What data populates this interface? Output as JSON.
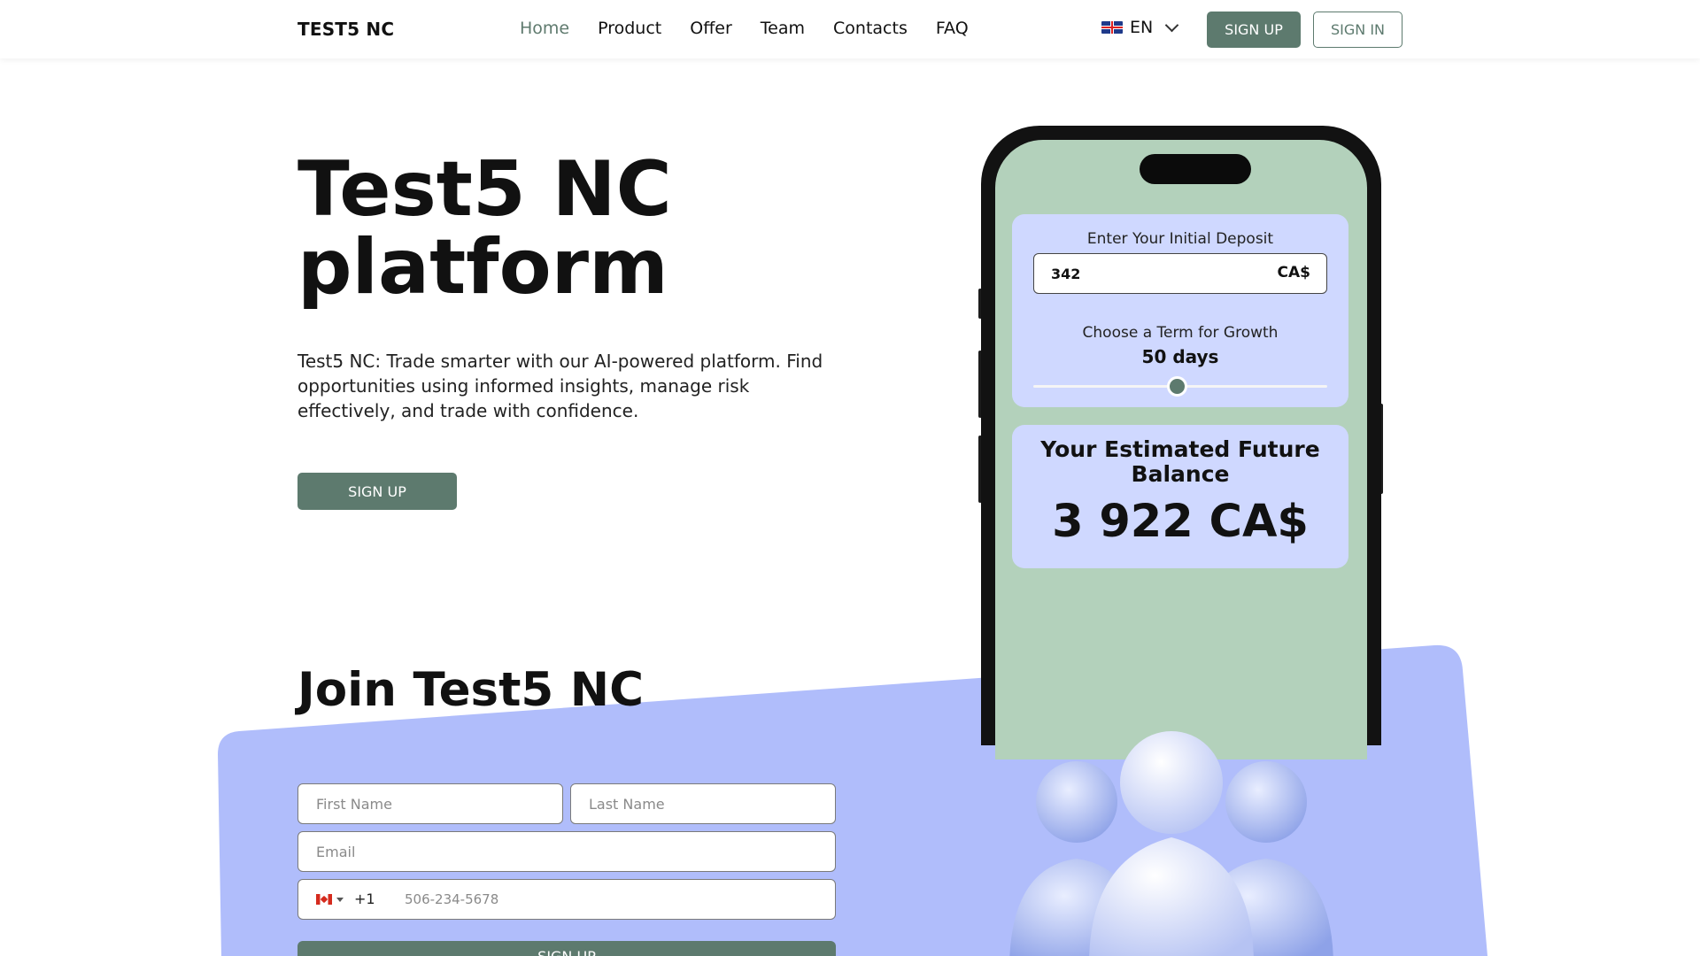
{
  "header": {
    "logo": "TEST5 NC",
    "nav": [
      {
        "label": "Home",
        "active": true
      },
      {
        "label": "Product",
        "active": false
      },
      {
        "label": "Offer",
        "active": false
      },
      {
        "label": "Team",
        "active": false
      },
      {
        "label": "Contacts",
        "active": false
      },
      {
        "label": "FAQ",
        "active": false
      }
    ],
    "language": "EN",
    "language_flag_icon": "uk-flag-icon",
    "signup_label": "SIGN UP",
    "signin_label": "SIGN IN"
  },
  "hero": {
    "title_line1": "Test5 NC",
    "title_line2": "platform",
    "description": "Test5 NC: Trade smarter with our AI-powered platform. Find opportunities using informed insights, manage risk effectively, and trade with confidence.",
    "cta_label": "SIGN UP"
  },
  "calculator": {
    "deposit_label": "Enter Your Initial Deposit",
    "deposit_value": "342",
    "currency": "CA$",
    "term_label": "Choose a Term for Growth",
    "term_value": "50 days",
    "slider_fraction": 0.49,
    "result_title": "Your Estimated Future Balance",
    "result_amount": "3 922 CA$"
  },
  "join": {
    "title": "Join Test5 NC",
    "first_name_placeholder": "First Name",
    "last_name_placeholder": "Last Name",
    "email_placeholder": "Email",
    "country_flag_icon": "canada-flag-icon",
    "dial_code": "+1",
    "phone_placeholder": "506-234-5678",
    "submit_label": "SIGN UP"
  },
  "colors": {
    "accent": "#5d7a6e",
    "panel": "#b0bdfb",
    "phone_screen": "#b3d1bb",
    "card": "#cfd8ff"
  }
}
